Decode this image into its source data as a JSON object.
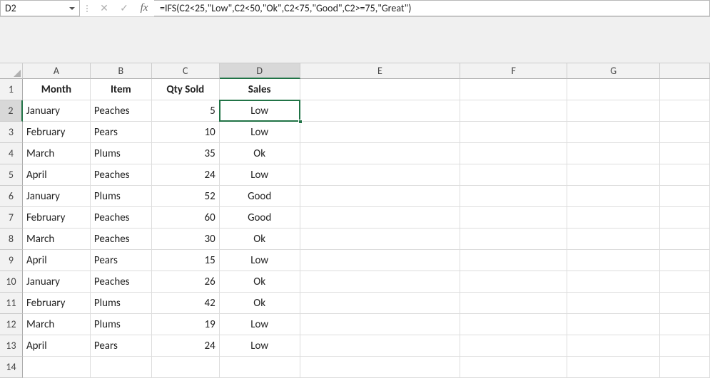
{
  "nameBox": "D2",
  "formula": "=IFS(C2<25,\"Low\",C2<50,\"Ok\",C2<75,\"Good\",C2>=75,\"Great\")",
  "fbButtons": {
    "cancel": "✕",
    "confirm": "✓",
    "fx": "fx"
  },
  "columns": [
    "A",
    "B",
    "C",
    "D",
    "E",
    "F",
    "G",
    ""
  ],
  "selectedCol": "D",
  "rows": [
    {
      "n": "1",
      "A": "Month",
      "B": "Item",
      "C": "Qty Sold",
      "D": "Sales",
      "header": true
    },
    {
      "n": "2",
      "A": "January",
      "B": "Peaches",
      "C": "5",
      "D": "Low",
      "sel": true
    },
    {
      "n": "3",
      "A": "February",
      "B": "Pears",
      "C": "10",
      "D": "Low"
    },
    {
      "n": "4",
      "A": "March",
      "B": "Plums",
      "C": "35",
      "D": "Ok"
    },
    {
      "n": "5",
      "A": "April",
      "B": "Peaches",
      "C": "24",
      "D": "Low"
    },
    {
      "n": "6",
      "A": "January",
      "B": "Plums",
      "C": "52",
      "D": "Good"
    },
    {
      "n": "7",
      "A": "February",
      "B": "Peaches",
      "C": "60",
      "D": "Good"
    },
    {
      "n": "8",
      "A": "March",
      "B": "Peaches",
      "C": "30",
      "D": "Ok"
    },
    {
      "n": "9",
      "A": "April",
      "B": "Pears",
      "C": "15",
      "D": "Low"
    },
    {
      "n": "10",
      "A": "January",
      "B": "Peaches",
      "C": "26",
      "D": "Ok"
    },
    {
      "n": "11",
      "A": "February",
      "B": "Plums",
      "C": "42",
      "D": "Ok"
    },
    {
      "n": "12",
      "A": "March",
      "B": "Plums",
      "C": "19",
      "D": "Low"
    },
    {
      "n": "13",
      "A": "April",
      "B": "Pears",
      "C": "24",
      "D": "Low"
    },
    {
      "n": "14",
      "A": "",
      "B": "",
      "C": "",
      "D": ""
    }
  ]
}
